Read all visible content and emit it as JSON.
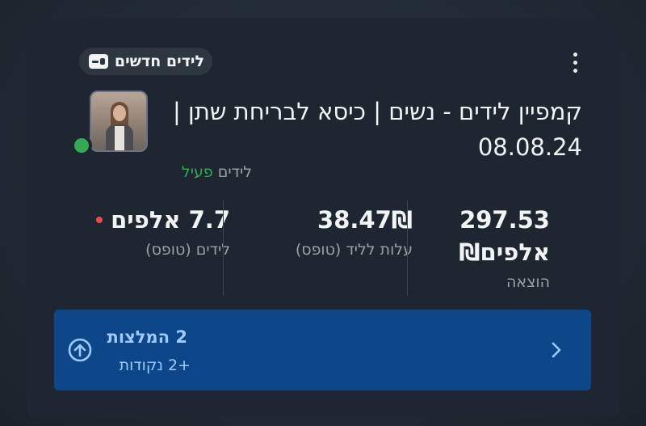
{
  "card": {
    "badge_label": "לידים חדשים",
    "badge_icon": "contact-card-icon",
    "menu_icon": "more-vert-icon",
    "title": "קמפיין לידים - נשים | כיסא לבריחת שתן | 08.08.24",
    "status_type": "לידים",
    "status_value": "פעיל",
    "status_color": "#34a853"
  },
  "metrics": [
    {
      "value": "7.7 אלפים",
      "label": "לידים (טופס)",
      "alert_color": "#e84b4b"
    },
    {
      "value": "38.47₪",
      "label": "עלות לליד (טופס)"
    },
    {
      "value": "297.53 אלפים₪",
      "label": "הוצאה"
    }
  ],
  "recommendations": {
    "title": "2 המלצות",
    "subtitle": "+2 נקודות",
    "icon": "arrow-up-circle-icon",
    "chevron": "chevron-right-icon",
    "background": "#0d4689"
  }
}
